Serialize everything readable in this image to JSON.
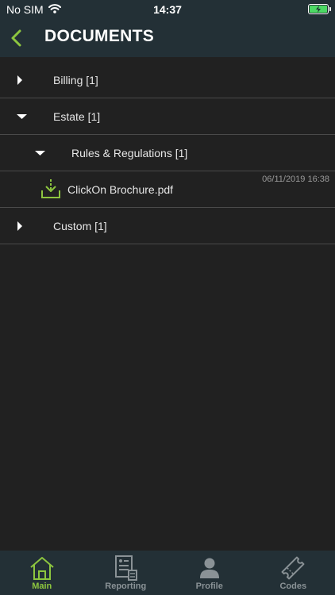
{
  "status_bar": {
    "carrier": "No SIM",
    "time": "14:37"
  },
  "header": {
    "title": "DOCUMENTS"
  },
  "tree": [
    {
      "label": "Billing [1]",
      "expanded": false
    },
    {
      "label": "Estate [1]",
      "expanded": true
    },
    {
      "label": "Rules & Regulations [1]",
      "expanded": true
    },
    {
      "label": "ClickOn Brochure.pdf",
      "date": "06/11/2019 16:38"
    },
    {
      "label": "Custom [1]",
      "expanded": false
    }
  ],
  "tabs": [
    {
      "label": "Main",
      "icon": "home-icon",
      "active": true
    },
    {
      "label": "Reporting",
      "icon": "report-icon",
      "active": false
    },
    {
      "label": "Profile",
      "icon": "person-icon",
      "active": false
    },
    {
      "label": "Codes",
      "icon": "ticket-icon",
      "active": false
    }
  ],
  "colors": {
    "accent": "#8dc63f",
    "bar_bg": "#233036",
    "page_bg": "#212121",
    "battery": "#4cd964"
  }
}
